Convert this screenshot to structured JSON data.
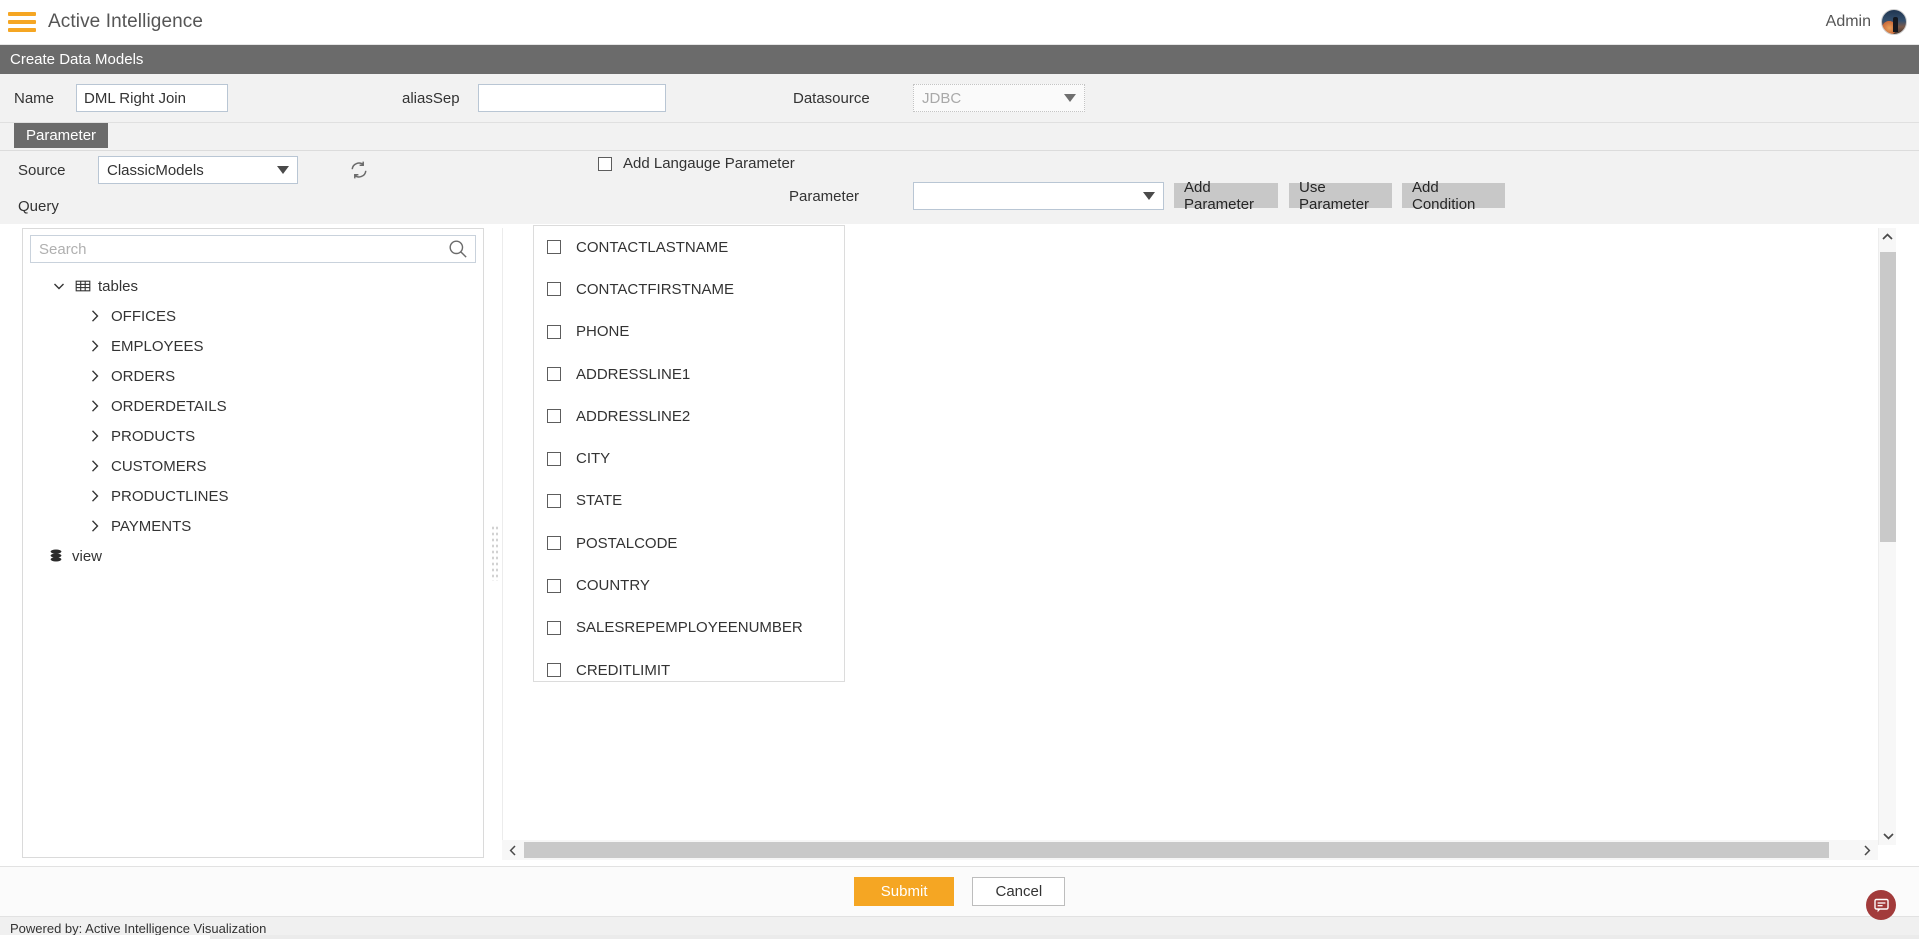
{
  "appbar": {
    "menu_icon": "hamburger-icon",
    "title": "Active Intelligence",
    "user_label": "Admin",
    "avatar_icon": "avatar"
  },
  "subheader": {
    "title": "Create Data Models"
  },
  "form": {
    "name_label": "Name",
    "name_value": "DML Right Join",
    "aliassep_label": "aliasSep",
    "aliassep_value": "",
    "aliassep_placeholder": "",
    "datasource_label": "Datasource",
    "datasource_value": "JDBC"
  },
  "tabs": [
    {
      "label": "Parameter",
      "active": true
    }
  ],
  "parameter_panel": {
    "source_label": "Source",
    "source_value": "ClassicModels",
    "refresh_icon": "refresh-icon",
    "add_language_parameter_label": "Add Langauge Parameter",
    "add_language_parameter_checked": false,
    "parameter_label": "Parameter",
    "parameter_value": "",
    "buttons": [
      {
        "label": "Add Parameter"
      },
      {
        "label": "Use Parameter"
      },
      {
        "label": "Add Condition"
      }
    ]
  },
  "query": {
    "label": "Query",
    "search_placeholder": "Search",
    "search_value": "",
    "tree": {
      "root_label": "tables",
      "root_icon": "grid-icon",
      "root_expanded": true,
      "children": [
        {
          "label": "OFFICES"
        },
        {
          "label": "EMPLOYEES"
        },
        {
          "label": "ORDERS"
        },
        {
          "label": "ORDERDETAILS"
        },
        {
          "label": "PRODUCTS"
        },
        {
          "label": "CUSTOMERS"
        },
        {
          "label": "PRODUCTLINES"
        },
        {
          "label": "PAYMENTS"
        }
      ],
      "view_label": "view",
      "view_icon": "database-icon"
    },
    "fields": [
      {
        "label": "CONTACTLASTNAME",
        "checked": false
      },
      {
        "label": "CONTACTFIRSTNAME",
        "checked": false
      },
      {
        "label": "PHONE",
        "checked": false
      },
      {
        "label": "ADDRESSLINE1",
        "checked": false
      },
      {
        "label": "ADDRESSLINE2",
        "checked": false
      },
      {
        "label": "CITY",
        "checked": false
      },
      {
        "label": "STATE",
        "checked": false
      },
      {
        "label": "POSTALCODE",
        "checked": false
      },
      {
        "label": "COUNTRY",
        "checked": false
      },
      {
        "label": "SALESREPEMPLOYEENUMBER",
        "checked": false
      },
      {
        "label": "CREDITLIMIT",
        "checked": false
      }
    ]
  },
  "actions": {
    "submit_label": "Submit",
    "cancel_label": "Cancel"
  },
  "footer": {
    "powered_by": "Powered by: Active Intelligence Visualization",
    "chat_icon": "chat-icon"
  },
  "colors": {
    "accent": "#f5a623",
    "header_gray": "#6b6b6b",
    "panel_bg": "#f2f2f2",
    "chat_fab": "#a23b3b"
  }
}
